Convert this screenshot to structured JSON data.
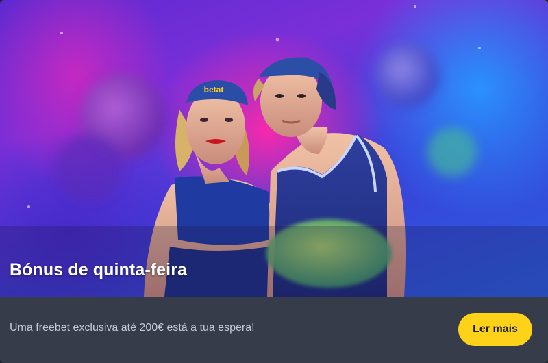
{
  "promo": {
    "title": "Bónus de quinta-feira",
    "description": "Uma freebet exclusiva até 200€ está a tua espera!",
    "cta_label": "Ler mais",
    "cap_logo_text": "betat"
  },
  "colors": {
    "accent": "#ffd21a",
    "footer_bg": "#363c4a",
    "description_text": "#c4c9d4"
  }
}
